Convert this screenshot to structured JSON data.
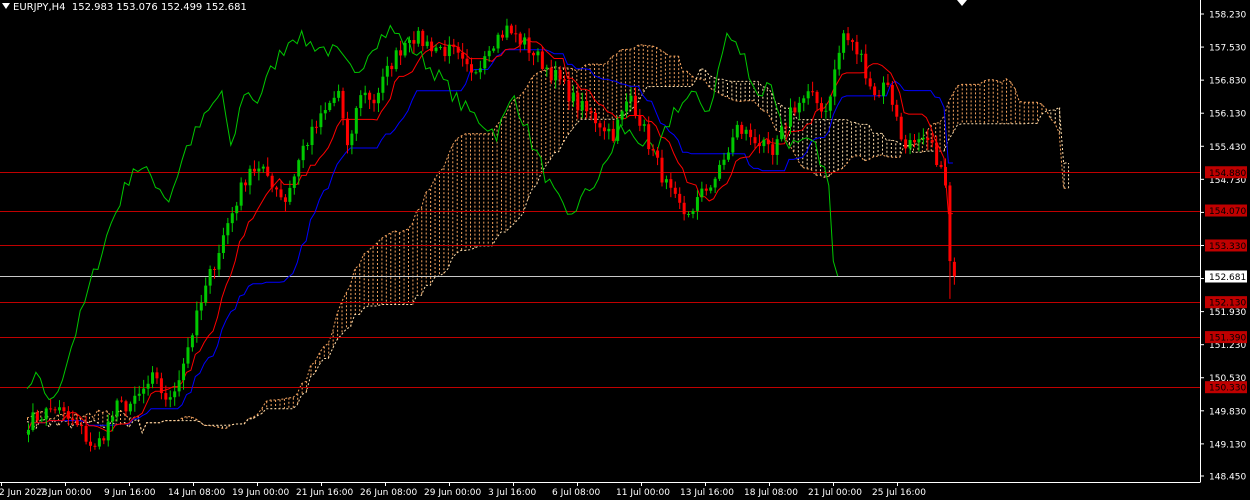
{
  "header": {
    "symbol": "EURJPY,H4",
    "ohlc": "152.983 153.076 152.499 152.681"
  },
  "colors": {
    "background": "#000000",
    "bull": "#00c800",
    "bear": "#ff0000",
    "tenkan": "#ff0000",
    "kijun": "#0000ff",
    "chikou": "#00c800",
    "span_a": "#f4a460",
    "span_b": "#ffdead",
    "level_line": "#c00000",
    "current_line": "#c8c8c8",
    "axis": "#ffffff"
  },
  "price_axis": {
    "min": 148.45,
    "max": 158.23,
    "ticks": [
      "158.230",
      "157.530",
      "156.830",
      "156.130",
      "155.430",
      "154.730",
      "154.030",
      "153.330",
      "152.630",
      "151.930",
      "151.230",
      "150.530",
      "149.830",
      "149.130",
      "148.450"
    ]
  },
  "time_axis": {
    "labels": [
      "2 Jun 2023",
      "7 Jun 00:00",
      "9 Jun 16:00",
      "14 Jun 08:00",
      "19 Jun 00:00",
      "21 Jun 16:00",
      "26 Jun 08:00",
      "29 Jun 00:00",
      "3 Jul 16:00",
      "6 Jul 08:00",
      "11 Jul 00:00",
      "13 Jul 16:00",
      "18 Jul 08:00",
      "21 Jul 00:00",
      "25 Jul 16:00"
    ]
  },
  "levels": [
    {
      "label": "154.880",
      "price": 154.88
    },
    {
      "label": "154.070",
      "price": 154.07
    },
    {
      "label": "153.330",
      "price": 153.33
    },
    {
      "label": "152.130",
      "price": 152.13
    },
    {
      "label": "151.390",
      "price": 151.39
    },
    {
      "label": "150.330",
      "price": 150.33
    }
  ],
  "current_price": {
    "label": "152.681",
    "price": 152.681
  },
  "chart_data": {
    "type": "candlestick",
    "symbol": "EURJPY",
    "timeframe": "H4",
    "close_path": [
      {
        "t": 0,
        "p": 149.6
      },
      {
        "t": 6,
        "p": 149.9
      },
      {
        "t": 12,
        "p": 149.4
      },
      {
        "t": 15,
        "p": 149.0
      },
      {
        "t": 20,
        "p": 149.9
      },
      {
        "t": 24,
        "p": 150.0
      },
      {
        "t": 28,
        "p": 150.5
      },
      {
        "t": 32,
        "p": 150.0
      },
      {
        "t": 36,
        "p": 151.2
      },
      {
        "t": 41,
        "p": 152.7
      },
      {
        "t": 45,
        "p": 153.8
      },
      {
        "t": 50,
        "p": 155.0
      },
      {
        "t": 54,
        "p": 154.8
      },
      {
        "t": 58,
        "p": 154.3
      },
      {
        "t": 62,
        "p": 155.4
      },
      {
        "t": 66,
        "p": 156.0
      },
      {
        "t": 70,
        "p": 156.6
      },
      {
        "t": 72,
        "p": 155.3
      },
      {
        "t": 75,
        "p": 156.6
      },
      {
        "t": 78,
        "p": 156.4
      },
      {
        "t": 82,
        "p": 157.2
      },
      {
        "t": 86,
        "p": 157.8
      },
      {
        "t": 90,
        "p": 157.6
      },
      {
        "t": 96,
        "p": 157.4
      },
      {
        "t": 100,
        "p": 156.9
      },
      {
        "t": 104,
        "p": 157.6
      },
      {
        "t": 108,
        "p": 157.9
      },
      {
        "t": 112,
        "p": 157.6
      },
      {
        "t": 116,
        "p": 157.2
      },
      {
        "t": 120,
        "p": 156.8
      },
      {
        "t": 124,
        "p": 156.3
      },
      {
        "t": 128,
        "p": 156.0
      },
      {
        "t": 132,
        "p": 155.7
      },
      {
        "t": 136,
        "p": 156.5
      },
      {
        "t": 140,
        "p": 155.5
      },
      {
        "t": 144,
        "p": 154.6
      },
      {
        "t": 148,
        "p": 153.9
      },
      {
        "t": 152,
        "p": 154.4
      },
      {
        "t": 156,
        "p": 154.9
      },
      {
        "t": 160,
        "p": 155.8
      },
      {
        "t": 164,
        "p": 155.6
      },
      {
        "t": 168,
        "p": 155.2
      },
      {
        "t": 172,
        "p": 156.2
      },
      {
        "t": 176,
        "p": 156.5
      },
      {
        "t": 180,
        "p": 156.2
      },
      {
        "t": 184,
        "p": 157.8
      },
      {
        "t": 188,
        "p": 157.3
      },
      {
        "t": 191,
        "p": 156.5
      },
      {
        "t": 194,
        "p": 156.8
      },
      {
        "t": 197,
        "p": 155.6
      },
      {
        "t": 200,
        "p": 155.4
      },
      {
        "t": 203,
        "p": 155.5
      },
      {
        "t": 205,
        "p": 155.2
      },
      {
        "t": 207,
        "p": 154.6
      },
      {
        "t": 208,
        "p": 153.0
      },
      {
        "t": 209,
        "p": 152.68
      }
    ]
  }
}
